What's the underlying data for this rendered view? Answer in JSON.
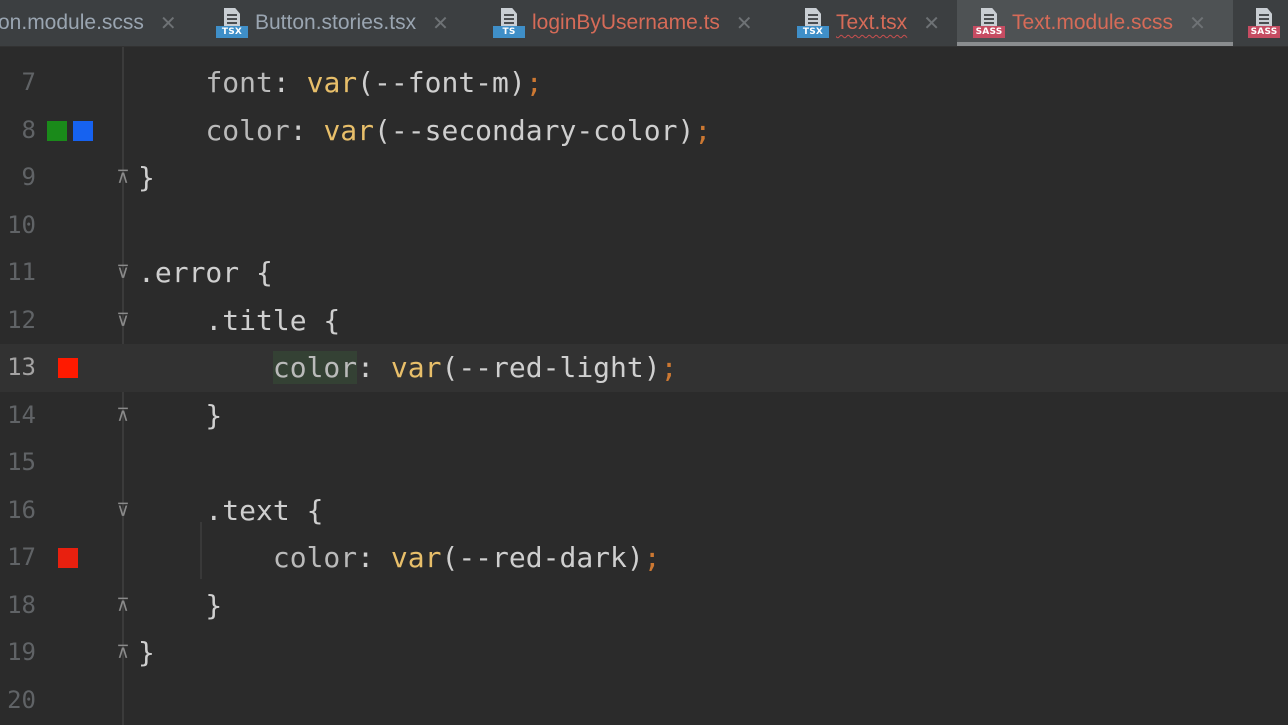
{
  "tabs": [
    {
      "label": "on.module.scss",
      "icon": null
    },
    {
      "label": "Button.stories.tsx",
      "icon": "TSX"
    },
    {
      "label": "loginByUsername.ts",
      "icon": "TS"
    },
    {
      "label": "Text.tsx",
      "icon": "TSX"
    },
    {
      "label": "Text.module.scss",
      "icon": "SASS"
    },
    {
      "label": "",
      "icon": "SASS"
    }
  ],
  "close_glyph": "✕",
  "editor": {
    "lines": [
      {
        "num": "7",
        "indent": "    ",
        "prop": "font",
        "sep": ": ",
        "fn": "var",
        "open": "(",
        "arg": "--font-m",
        "close": ")",
        "semi": ";"
      },
      {
        "num": "8",
        "indent": "    ",
        "prop": "color",
        "sep": ": ",
        "fn": "var",
        "open": "(",
        "arg": "--secondary-color",
        "close": ")",
        "semi": ";",
        "swatches": [
          "#1a8a1a",
          "#1662f0"
        ]
      },
      {
        "num": "9",
        "text": "}"
      },
      {
        "num": "10"
      },
      {
        "num": "11",
        "text": ".error {"
      },
      {
        "num": "12",
        "text": "    .title {"
      },
      {
        "num": "13",
        "indent": "        ",
        "prop": "color",
        "sep": ": ",
        "fn": "var",
        "open": "(",
        "arg": "--red-light",
        "close": ")",
        "semi": ";",
        "swatches": [
          "#ff1a00"
        ]
      },
      {
        "num": "14",
        "text": "    }"
      },
      {
        "num": "15"
      },
      {
        "num": "16",
        "text": "    .text {"
      },
      {
        "num": "17",
        "indent": "        ",
        "prop": "color",
        "sep": ": ",
        "fn": "var",
        "open": "(",
        "arg": "--red-dark",
        "close": ")",
        "semi": ";",
        "swatches": [
          "#e8200f"
        ]
      },
      {
        "num": "18",
        "text": "    }"
      },
      {
        "num": "19",
        "text": "}"
      },
      {
        "num": "20"
      }
    ]
  },
  "colors": {
    "editor_bg": "#2b2b2b",
    "current_line": "#323232",
    "function": "#e8bf6a",
    "punctuation": "#cc7832",
    "text": "#a9b7c6"
  }
}
